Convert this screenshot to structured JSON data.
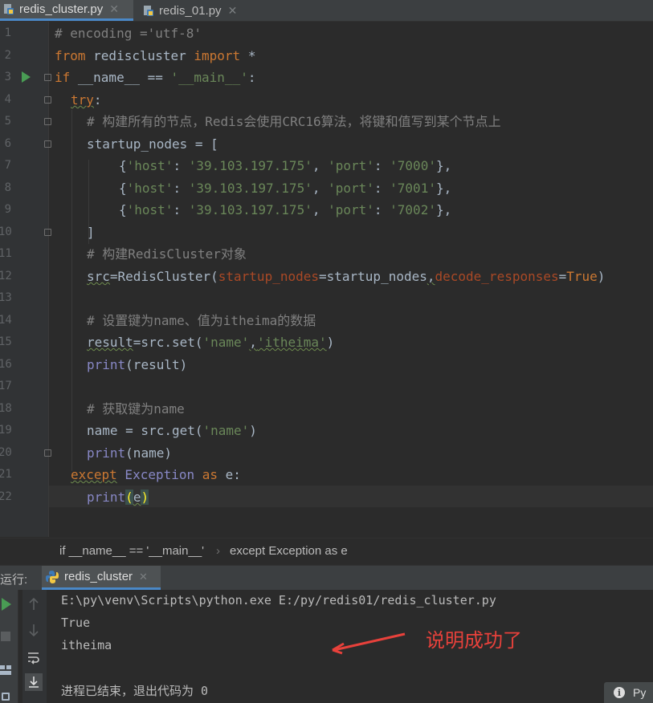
{
  "tabs": [
    {
      "label": "redis_cluster.py",
      "active": true
    },
    {
      "label": "redis_01.py",
      "active": false
    }
  ],
  "editor": {
    "line_numbers": [
      "1",
      "2",
      "3",
      "4",
      "5",
      "6",
      "7",
      "8",
      "9",
      "10",
      "11",
      "12",
      "13",
      "14",
      "15",
      "16",
      "17",
      "18",
      "19",
      "20",
      "21",
      "22"
    ],
    "code": {
      "l1": "# encoding ='utf-8'",
      "l2_kw1": "from",
      "l2_mod": " rediscluster ",
      "l2_kw2": "import",
      "l2_star": " *",
      "l3_kw": "if",
      "l3_a": " __name__ == ",
      "l3_str": "'__main__'",
      "l3_b": ":",
      "l4_kw": "try",
      "l4_b": ":",
      "l5": "# 构建所有的节点，Redis会使用CRC16算法，将键和值写到某个节点上",
      "l6": "startup_nodes = [",
      "node_host_key": "'host'",
      "node_host_val": "'39.103.197.175'",
      "node_port_key": "'port'",
      "l7_port": "'7000'",
      "l8_port": "'7001'",
      "l9_port": "'7002'",
      "l10": "]",
      "l11": "# 构建RedisCluster对象",
      "l12_a": "src",
      "l12_b": "=RedisCluster(",
      "l12_kw1": "startup_nodes",
      "l12_c": "=startup_nodes",
      "l12_comma": ",",
      "l12_kw2": "decode_responses",
      "l12_d": "=",
      "l12_true": "True",
      "l12_e": ")",
      "l14": "# 设置键为name、值为itheima的数据",
      "l15_a": "result",
      "l15_b": "=src.set(",
      "l15_s1": "'name'",
      "l15_comma": ",",
      "l15_s2": "'itheima'",
      "l15_c": ")",
      "l16_fn": "print",
      "l16_b": "(result)",
      "l18": "# 获取键为name",
      "l19_a": "name = src.get(",
      "l19_s": "'name'",
      "l19_b": ")",
      "l20_fn": "print",
      "l20_b": "(name)",
      "l21_kw1": "except",
      "l21_cls": " Exception ",
      "l21_kw2": "as",
      "l21_b": " e:",
      "l22_fn": "print",
      "l22_p1": "(",
      "l22_e": "e",
      "l22_p2": ")"
    }
  },
  "breadcrumb": {
    "first": "if __name__ == '__main__'",
    "separator": "›",
    "second": "except Exception as e"
  },
  "run": {
    "label": "运行:",
    "tab_label": "redis_cluster",
    "output": [
      "E:\\py\\venv\\Scripts\\python.exe E:/py/redis01/redis_cluster.py",
      "True",
      "itheima",
      "",
      "进程已结束，退出代码为 0"
    ]
  },
  "annotation": {
    "text": "说明成功了",
    "color": "#e8413b"
  },
  "notification": {
    "text": "Py"
  },
  "colors": {
    "keyword": "#cc7832",
    "string": "#6a8759",
    "comment": "#808080",
    "builtin": "#8888c6",
    "kwarg": "#aa4926",
    "run_green": "#499c54"
  }
}
